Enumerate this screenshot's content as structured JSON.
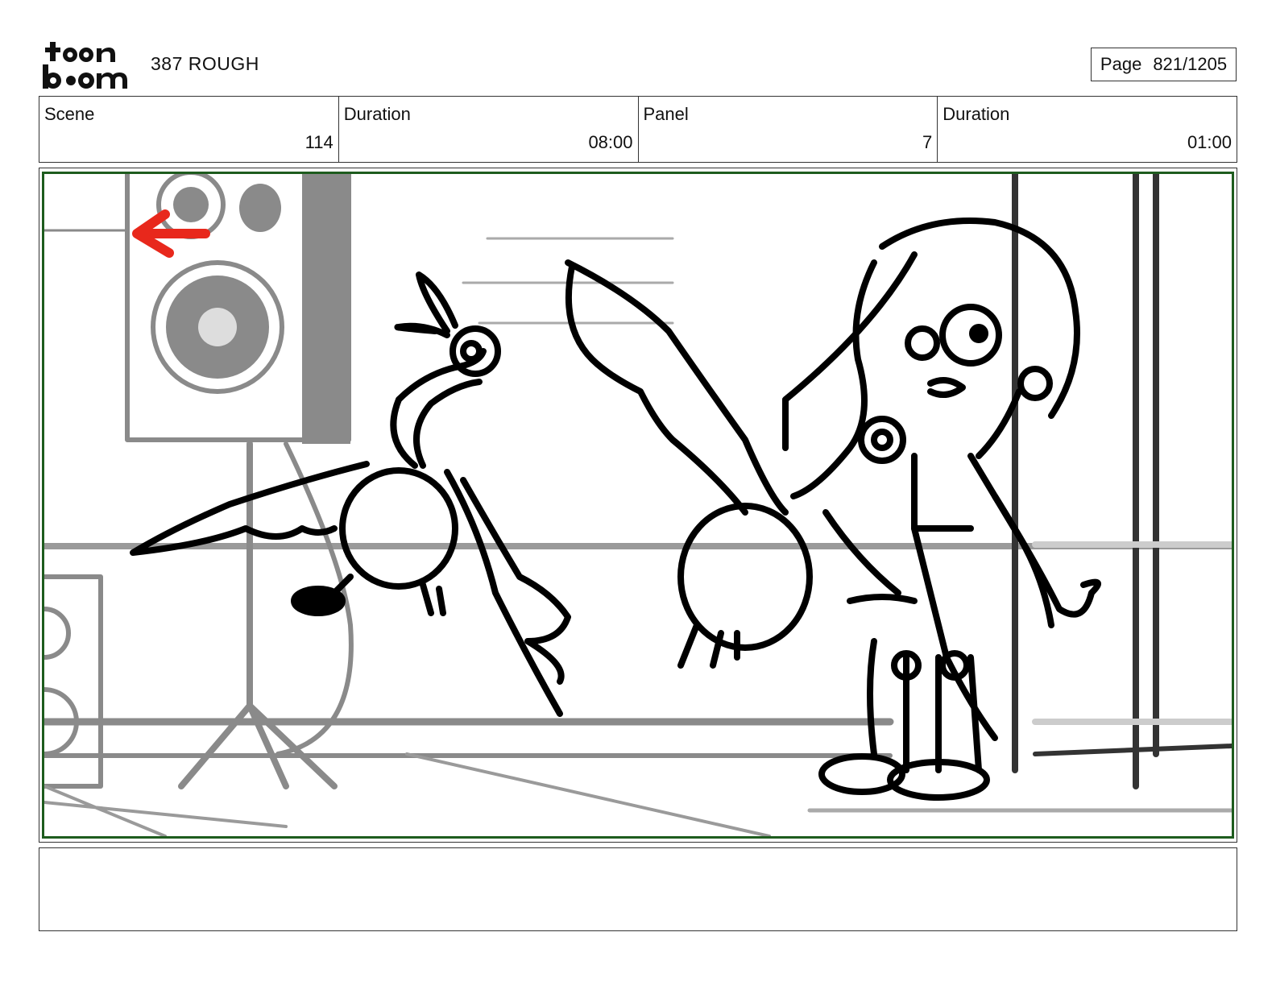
{
  "header": {
    "logo_text": "toon boom",
    "project_title": "387 ROUGH",
    "page_label": "Page",
    "page_value": "821/1205"
  },
  "info": {
    "scene_label": "Scene",
    "scene_value": "114",
    "scene_duration_label": "Duration",
    "scene_duration_value": "08:00",
    "panel_label": "Panel",
    "panel_value": "7",
    "panel_duration_label": "Duration",
    "panel_duration_value": "01:00"
  },
  "colors": {
    "frame_border": "#1e5c1e",
    "arrow": "#e8281c",
    "background_gray": "#8a8a8a"
  }
}
